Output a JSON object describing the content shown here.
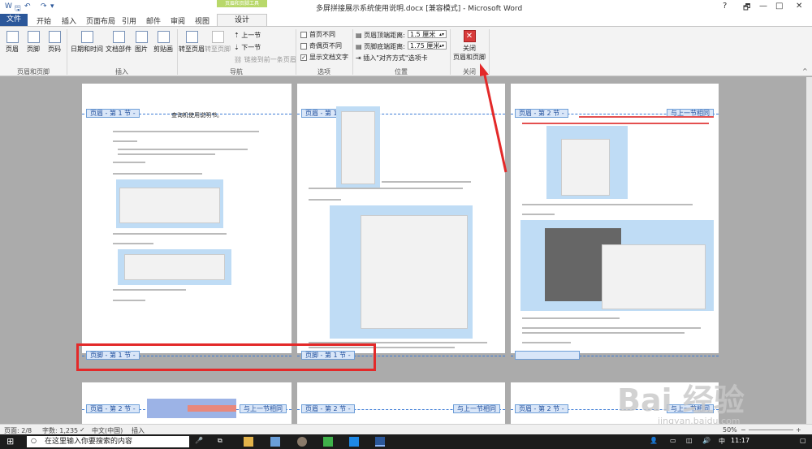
{
  "window": {
    "title": "多屏拼接展示系统使用说明.docx [兼容模式] - Microsoft Word",
    "context_tab": "页眉和页脚工具",
    "help": "?",
    "restore": "🗗",
    "minimize": "—",
    "maximize": "□",
    "close": "✕"
  },
  "quick_access": {
    "save": "🖫",
    "undo": "↶",
    "redo": "↷",
    "customize": "▾"
  },
  "tabs": [
    "文件",
    "开始",
    "插入",
    "页面布局",
    "引用",
    "邮件",
    "审阅",
    "视图",
    "设计"
  ],
  "ribbon": {
    "header_footer_group": {
      "label": "页眉和页脚",
      "header": "页眉",
      "footer": "页脚",
      "page_number": "页码"
    },
    "insert_group": {
      "label": "插入",
      "datetime": "日期和时间",
      "docparts": "文档部件",
      "picture": "图片",
      "clipart": "剪贴画"
    },
    "nav_group": {
      "label": "导航",
      "goto_header": "转至页眉",
      "goto_footer": "转至页脚",
      "prev": "上一节",
      "next": "下一节",
      "link": "链接到前一条页眉"
    },
    "options_group": {
      "label": "选项",
      "diff_first": "首页不同",
      "diff_oddeven": "奇偶页不同",
      "show_text": "显示文档文字"
    },
    "position_group": {
      "label": "位置",
      "header_top": "页眉顶端距离:",
      "header_top_value": "1.5 厘米",
      "footer_bottom": "页脚底端距离:",
      "footer_bottom_value": "1.75 厘米",
      "insert_tab": "插入\"对齐方式\"选项卡"
    },
    "close_group": {
      "label": "关闭",
      "close_btn_line1": "关闭",
      "close_btn_line2": "页眉和页脚"
    }
  },
  "pages": {
    "header_sec1": "页眉 - 第 1 节 -",
    "header_sec2": "页眉 - 第 2 节 -",
    "footer_sec1": "页脚 - 第 1 节 -",
    "same_as_prev": "与上一节相同",
    "page1_title": "查询机使用说明书。"
  },
  "status": {
    "page": "页面: 2/8",
    "words": "字数: 1,235",
    "language": "中文(中国)",
    "insert": "插入",
    "zoom": "50%"
  },
  "taskbar": {
    "search_placeholder": "在这里输入你要搜索的内容",
    "time": "11:17",
    "ime": "中"
  },
  "watermark": {
    "logo": "Bai 经验",
    "url": "jingyan.baidu.com"
  }
}
